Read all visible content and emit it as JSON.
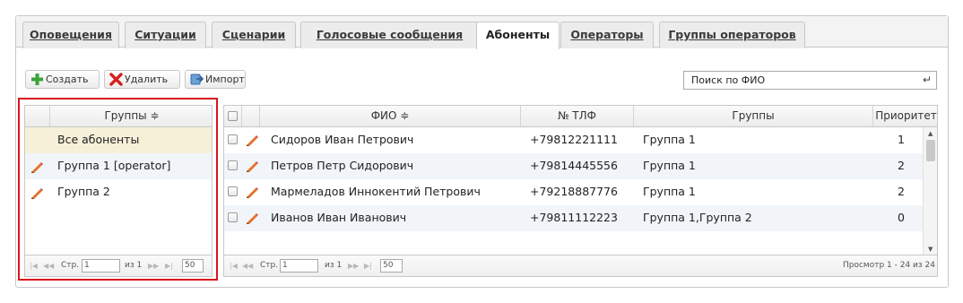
{
  "tabs": [
    {
      "label": "Оповещения"
    },
    {
      "label": "Ситуации"
    },
    {
      "label": "Сценарии"
    },
    {
      "label": "Голосовые сообщения"
    },
    {
      "label": "Абоненты"
    },
    {
      "label": "Операторы"
    },
    {
      "label": "Группы операторов"
    }
  ],
  "active_tab": "Абоненты",
  "toolbar": {
    "create_label": "Создать",
    "delete_label": "Удалить",
    "import_label": "Импорт"
  },
  "search": {
    "placeholder": "Поиск по ФИО",
    "enter_symbol": "↵"
  },
  "groups_grid": {
    "header": "Группы ≑",
    "rows": [
      {
        "name": "Все абоненты",
        "editable": false,
        "selected": true
      },
      {
        "name": "Группа 1 [operator]",
        "editable": true,
        "selected": false
      },
      {
        "name": "Группа 2",
        "editable": true,
        "selected": false
      }
    ],
    "pager": {
      "page_label": "Стр.",
      "page_value": "1",
      "of_label": "из 1",
      "per_page": "50"
    }
  },
  "subscribers_grid": {
    "columns": {
      "fio": "ФИО ≑",
      "phone": "№ ТЛФ",
      "groups": "Группы",
      "priority": "Приоритет"
    },
    "rows": [
      {
        "fio": "Сидоров Иван Петрович",
        "phone": "+79812221111",
        "groups": "Группа 1",
        "priority": "1"
      },
      {
        "fio": "Петров Петр Сидорович",
        "phone": "+79814445556",
        "groups": "Группа 1",
        "priority": "2"
      },
      {
        "fio": "Мармеладов Иннокентий Петрович",
        "phone": "+79218887776",
        "groups": "Группа 1",
        "priority": "2"
      },
      {
        "fio": "Иванов Иван Иванович",
        "phone": "+79811112223",
        "groups": "Группа 1,Группа 2",
        "priority": "0"
      }
    ],
    "pager": {
      "page_label": "Стр.",
      "page_value": "1",
      "of_label": "из 1",
      "per_page": "50",
      "view_info": "Просмотр 1 - 24 из 24"
    }
  },
  "icons": {
    "create": "plus-icon",
    "delete": "x-icon",
    "import": "import-icon",
    "edit": "pencil-icon"
  },
  "colors": {
    "selected_row": "#f7f0d8",
    "highlight_border": "#d9161e",
    "create_icon": "#3aa53a",
    "delete_icon": "#d81e1e",
    "pencil": "#e8702a"
  }
}
